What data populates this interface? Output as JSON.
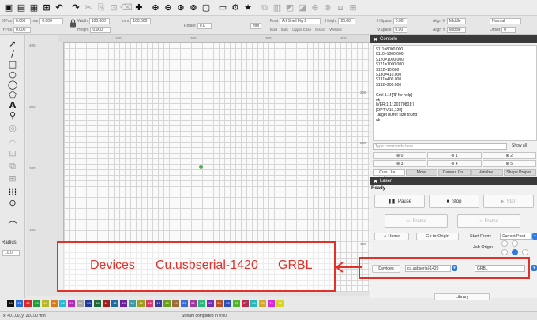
{
  "toolbar": {
    "icons": [
      "open-icon",
      "save-icon",
      "save-as-icon",
      "import-icon",
      "undo-icon",
      "redo-icon",
      "cut-icon",
      "copy-icon",
      "paste-icon",
      "delete-icon",
      "move-icon",
      "zoom-in-icon",
      "zoom-out-icon",
      "zoom-fit-icon",
      "zoom-selection-icon",
      "frame-icon",
      "monitor-icon",
      "settings-icon",
      "star-icon",
      "group-icon",
      "align-icon",
      "flip-icon",
      "mirror-icon",
      "node-icon",
      "weld-icon",
      "boolean-icon",
      "grid-snap-icon"
    ]
  },
  "property_bar": {
    "xpos": {
      "label": "XPos",
      "value": "0.000"
    },
    "ypos": {
      "label": "YPos",
      "value": "0.000"
    },
    "width": {
      "label": "mm",
      "value": "0.000"
    },
    "height": {
      "label": "Height",
      "value": "0.000"
    },
    "width_pct": {
      "label": "Width",
      "value": "100.000"
    },
    "height_pct": {
      "label": "mm",
      "value": "100.000"
    },
    "rotate": {
      "label": "Rotate",
      "value": "0.0"
    },
    "unit": "mm",
    "font": {
      "label": "Font",
      "value": "Arl Shell Fig 2"
    },
    "font_height": {
      "label": "Height",
      "value": "25.00"
    },
    "hspace": {
      "label": "HSpace",
      "value": "0.00"
    },
    "vspace": {
      "label": "VSpace",
      "value": "0.00"
    },
    "align_x": {
      "label": "Align X",
      "value": "Middle"
    },
    "align_y": {
      "label": "Align Y",
      "value": "Middle"
    },
    "normal": "Normal",
    "offset": {
      "label": "Offset",
      "value": "0"
    },
    "style_options": [
      "Bold",
      "Italic",
      "Upper Case",
      "Distort",
      "Welded"
    ]
  },
  "left_tools": {
    "icons": [
      "select-icon",
      "line-icon",
      "rectangle-icon",
      "ellipse-icon",
      "circle-icon",
      "polygon-icon",
      "text-icon",
      "position-icon",
      "offset-icon",
      "trace-icon",
      "edit-nodes-icon",
      "grid-array-icon",
      "circular-array-icon",
      "radius-tool-icon"
    ],
    "radius_label": "Radius:",
    "radius_value": "10.0"
  },
  "canvas": {
    "ruler_labels_top": [
      "100",
      "200",
      "300",
      "400"
    ],
    "ruler_labels_left": [
      "400",
      "300",
      "200",
      "100"
    ]
  },
  "callout": {
    "devices": "Devices",
    "port": "Cu.usbserial-1420",
    "firmware": "GRBL"
  },
  "console": {
    "title": "Console",
    "lines": [
      "$111=8000.000",
      "$110=1000.000",
      "$120=1000.000",
      "$121=1000.000",
      "$122=10.000",
      "$130=410.000",
      "$131=400.000",
      "$132=200.000",
      "",
      "Grbl 1.1f ['$' for help]",
      "ok",
      "[VER:1.1f.20170801:]",
      "[OPT:V,15,128]",
      "Target buffer size found",
      "ok"
    ],
    "input_placeholder": "Type commands here",
    "show_all": "Show all",
    "macros": [
      "0",
      "1",
      "2",
      "3",
      "4",
      "5"
    ],
    "tabs": [
      "Cuts / La...",
      "Move",
      "Camera Co...",
      "Variable...",
      "Shape Proper..."
    ]
  },
  "laser": {
    "title": "Laser",
    "status": "Ready",
    "pause": "Pause",
    "stop": "Stop",
    "start": "Start",
    "frame_rect": "Frame",
    "frame_circle": "Frame",
    "home": "Home",
    "go_to_origin": "Go to Origin",
    "start_from_label": "Start From:",
    "start_from_value": "Current Posit",
    "job_origin_label": "Job Origin",
    "devices": "Devices",
    "port": "cu.usbserial-1420",
    "firmware": "GRBL",
    "library": "Library"
  },
  "palette": {
    "swatches": [
      {
        "label": "00",
        "color": "#111111"
      },
      {
        "label": "01",
        "color": "#2a6bd6"
      },
      {
        "label": "02",
        "color": "#d62a2a"
      },
      {
        "label": "03",
        "color": "#1f9e3a"
      },
      {
        "label": "04",
        "color": "#b7b72a"
      },
      {
        "label": "05",
        "color": "#d67a1f"
      },
      {
        "label": "06",
        "color": "#2ab7d6"
      },
      {
        "label": "07",
        "color": "#b72ab7"
      },
      {
        "label": "08",
        "color": "#a8a8a8"
      },
      {
        "label": "09",
        "color": "#1f3a9e"
      },
      {
        "label": "10",
        "color": "#1f6a3a"
      },
      {
        "label": "11",
        "color": "#9e1f1f"
      },
      {
        "label": "12",
        "color": "#1f6a9e"
      },
      {
        "label": "13",
        "color": "#6a1f9e"
      },
      {
        "label": "14",
        "color": "#3a9e9e"
      },
      {
        "label": "15",
        "color": "#9e9e1f"
      },
      {
        "label": "16",
        "color": "#d63a6a"
      },
      {
        "label": "17",
        "color": "#3a3a9e"
      },
      {
        "label": "18",
        "color": "#6a9e1f"
      },
      {
        "label": "19",
        "color": "#9e6a3a"
      },
      {
        "label": "20",
        "color": "#3a6ad6"
      },
      {
        "label": "21",
        "color": "#9e3a9e"
      },
      {
        "label": "22",
        "color": "#2ab77a"
      },
      {
        "label": "23",
        "color": "#7a2ab7"
      },
      {
        "label": "24",
        "color": "#b7502a"
      },
      {
        "label": "25",
        "color": "#2a50b7"
      },
      {
        "label": "26",
        "color": "#50b72a"
      },
      {
        "label": "27",
        "color": "#b72a50"
      },
      {
        "label": "28",
        "color": "#2ab7b7"
      },
      {
        "label": "29",
        "color": "#d6a82a"
      },
      {
        "label": "T1",
        "color": "#d62ad6"
      },
      {
        "label": "T2",
        "color": "#d6d62a"
      }
    ]
  },
  "status_bar": {
    "coords": "x: 401.00, y: 210.00 mm",
    "message": "Stream completed in 0:00"
  },
  "colors": {
    "accent_red": "#e0312b",
    "accent_blue": "#2f7be0",
    "origin_green": "#4caf50"
  }
}
